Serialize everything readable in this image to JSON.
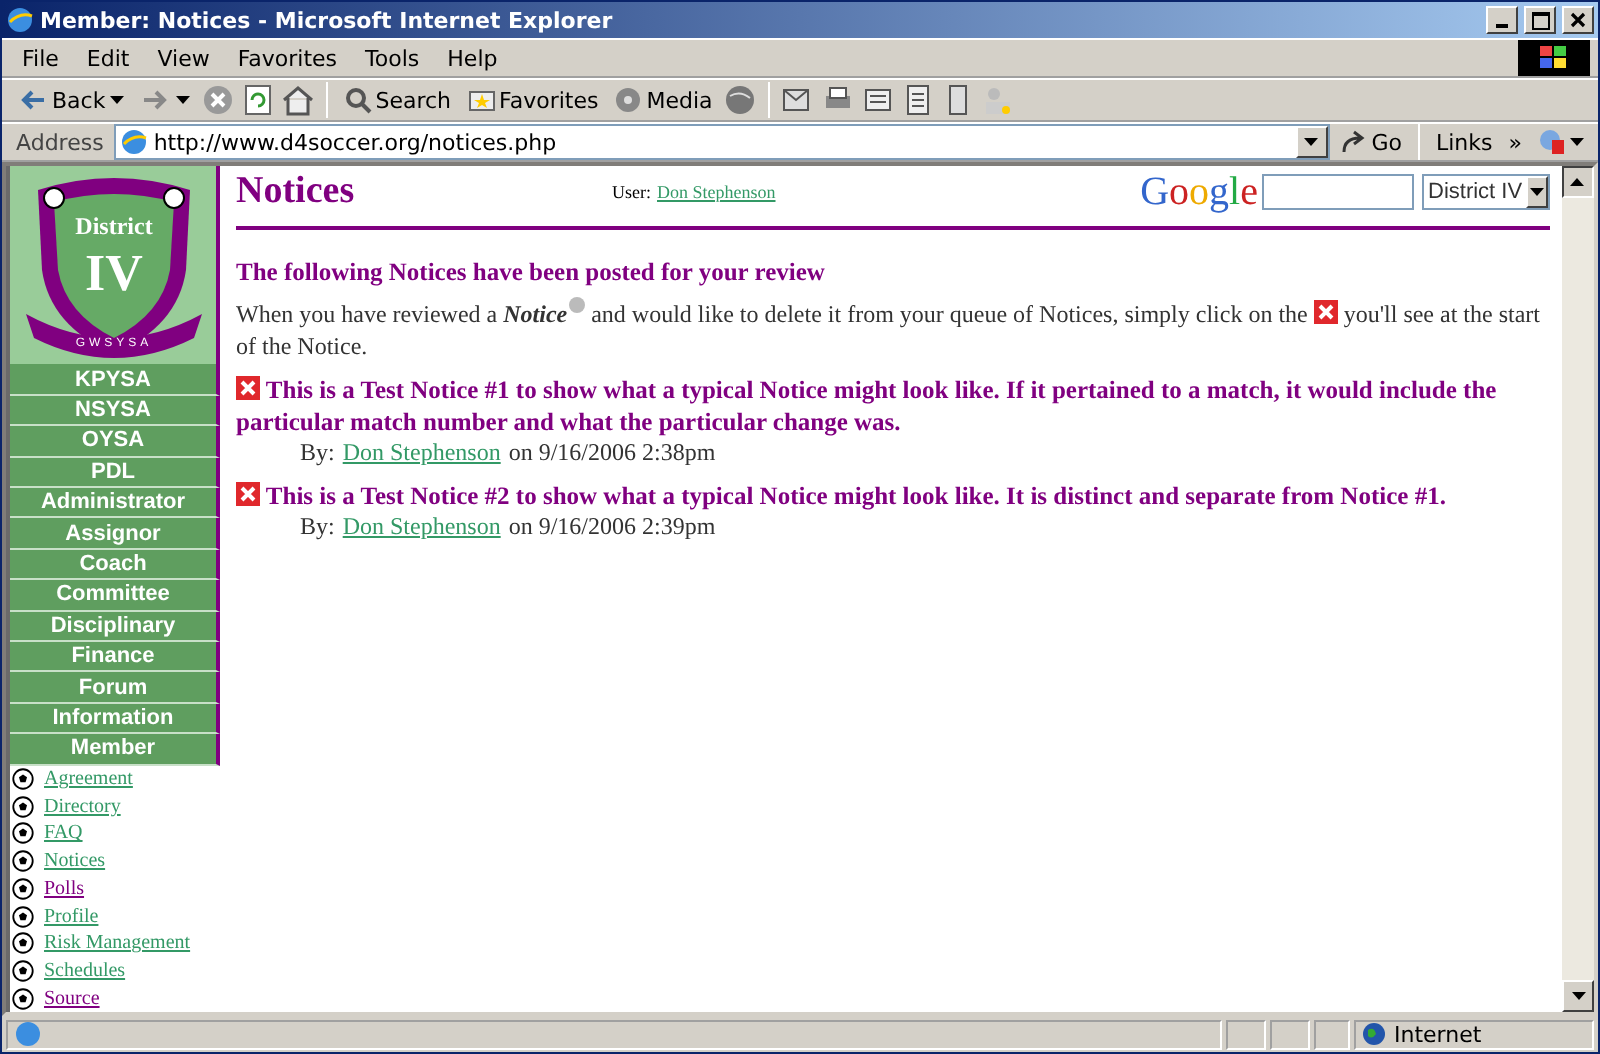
{
  "window": {
    "title": "Member: Notices - Microsoft Internet Explorer"
  },
  "menu": [
    "File",
    "Edit",
    "View",
    "Favorites",
    "Tools",
    "Help"
  ],
  "toolbar": {
    "back": "Back",
    "search": "Search",
    "favorites": "Favorites",
    "media": "Media"
  },
  "address_bar": {
    "label": "Address",
    "url": "http://www.d4soccer.org/notices.php",
    "go": "Go",
    "links": "Links",
    "chevron": "»"
  },
  "logo": {
    "line_1": "District",
    "line_2": "IV",
    "banner": "GWSYSA"
  },
  "nav": [
    "KPYSA",
    "NSYSA",
    "OYSA",
    "PDL",
    "Administrator",
    "Assignor",
    "Coach",
    "Committee",
    "Disciplinary",
    "Finance",
    "Forum",
    "Information",
    "Member"
  ],
  "member_links": [
    {
      "label": "Agreement",
      "visited": false
    },
    {
      "label": "Directory",
      "visited": false
    },
    {
      "label": "FAQ",
      "visited": false
    },
    {
      "label": "Notices",
      "visited": false
    },
    {
      "label": "Polls",
      "visited": true
    },
    {
      "label": "Profile",
      "visited": false
    },
    {
      "label": "Risk Management",
      "visited": false
    },
    {
      "label": "Schedules",
      "visited": false
    },
    {
      "label": "Source",
      "visited": true
    }
  ],
  "header": {
    "title": "Notices",
    "user_label": "User:",
    "user": "Don Stephenson",
    "search_brand": "Google",
    "district": "District IV"
  },
  "heading": "The following Notices have been posted for your review",
  "intro": {
    "before": "When you have reviewed a",
    "term": "Notice",
    "middle": "and would like to delete it from your queue of Notices, simply click on the",
    "after": "you'll see at the start of the Notice."
  },
  "notices": [
    {
      "text": "This is a Test Notice #1 to show what a typical Notice might look like. If it pertained to a match, it would include the particular match number and what the particular change was.",
      "by": "By:",
      "author": "Don Stephenson",
      "date": "on 9/16/2006 2:38pm"
    },
    {
      "text": "This is a Test Notice #2 to show what a typical Notice might look like. It is distinct and separate from Notice #1.",
      "by": "By:",
      "author": "Don Stephenson",
      "date": "on 9/16/2006 2:39pm"
    }
  ],
  "status_bar": {
    "zone": "Internet"
  }
}
